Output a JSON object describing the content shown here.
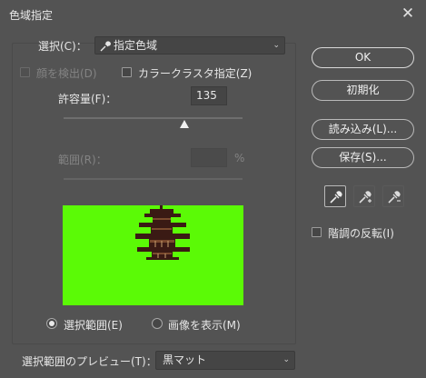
{
  "window": {
    "title": "色域指定",
    "close_glyph": "✕"
  },
  "select": {
    "label": "選択(C)：",
    "value": "指定色域",
    "icon": "eyedropper-icon",
    "arrow": "⌄"
  },
  "options": {
    "face_detect_label": "顔を検出(D)",
    "face_detect_checked": false,
    "cluster_label": "カラークラスタ指定(Z)",
    "cluster_checked": false
  },
  "tolerance": {
    "label": "許容量(F)：",
    "value": "135",
    "fraction": 0.66
  },
  "range": {
    "label": "範囲(R)：",
    "value": "",
    "unit": "%"
  },
  "preview_mode": {
    "selection_label": "選択範囲(E)",
    "image_label": "画像を表示(M)",
    "selected": "selection"
  },
  "preview_select": {
    "label": "選択範囲のプレビュー(T)：",
    "value": "黒マット",
    "arrow": "⌄"
  },
  "buttons": {
    "ok": "OK",
    "reset": "初期化",
    "load": "読み込み(L)...",
    "save": "保存(S)..."
  },
  "tools": [
    {
      "name": "eyedropper-icon",
      "active": true
    },
    {
      "name": "eyedropper-plus-icon",
      "active": false
    },
    {
      "name": "eyedropper-minus-icon",
      "active": false
    }
  ],
  "invert": {
    "label": "階調の反転(I)",
    "checked": false
  },
  "colors": {
    "background": "#535353",
    "preview_bg": "#5bfa06",
    "field_bg": "#454545",
    "text": "#e6e6e6",
    "disabled_text": "#838383"
  }
}
